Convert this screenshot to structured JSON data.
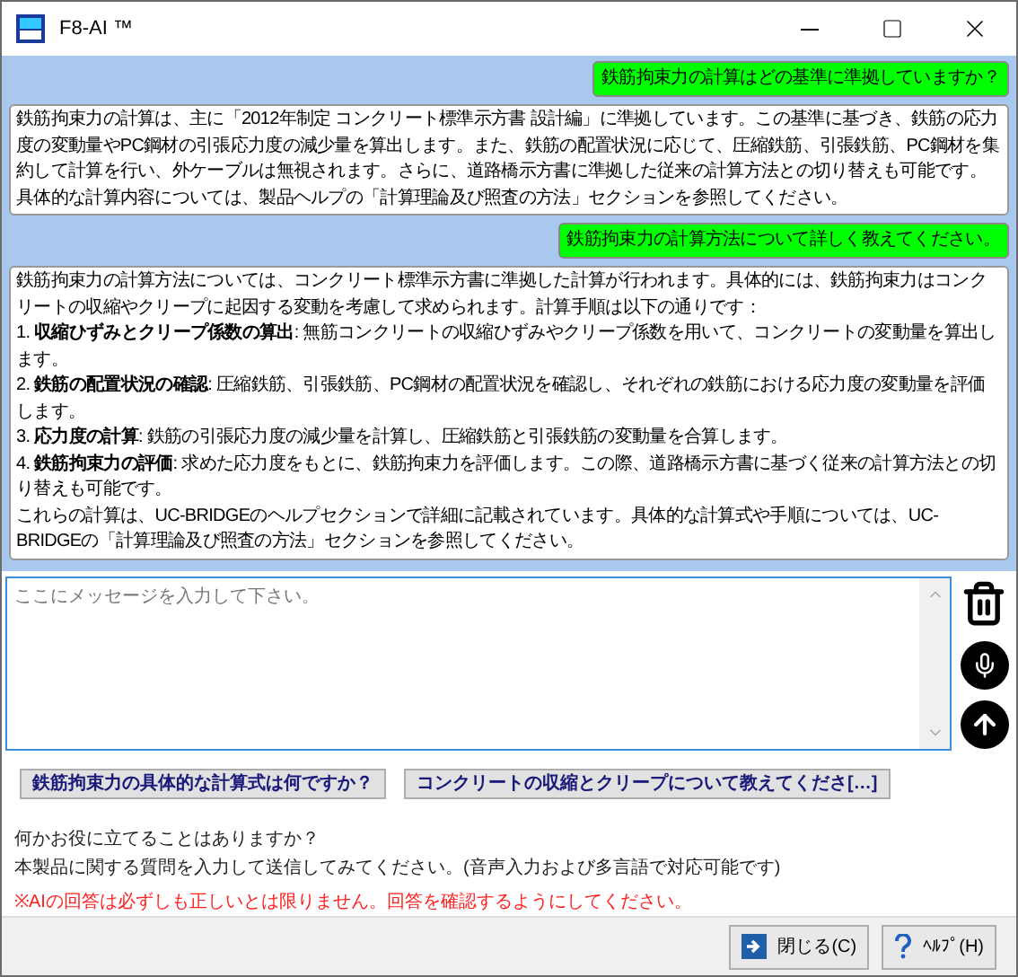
{
  "window": {
    "title": "F8-AI ™"
  },
  "messages": [
    {
      "kind": "user",
      "text": "鉄筋拘束力の計算はどの基準に準拠していますか？"
    },
    {
      "kind": "assistant",
      "paragraphs": [
        "鉄筋拘束力の計算は、主に「2012年制定 コンクリート標準示方書 設計編」に準拠しています。この基準に基づき、鉄筋の応力度の変動量やPC鋼材の引張応力度の減少量を算出します。また、鉄筋の配置状況に応じて、圧縮鉄筋、引張鉄筋、PC鋼材を集約して計算を行い、外ケーブルは無視されます。さらに、道路橋示方書に準拠した従来の計算方法との切り替えも可能です。具体的な計算内容については、製品ヘルプの「計算理論及び照査の方法」セクションを参照してください。"
      ]
    },
    {
      "kind": "user",
      "text": "鉄筋拘束力の計算方法について詳しく教えてください。"
    },
    {
      "kind": "assistant",
      "paragraphs": [
        "鉄筋拘束力の計算方法については、コンクリート標準示方書に準拠した計算が行われます。具体的には、鉄筋拘束力はコンクリートの収縮やクリープに起因する変動を考慮して求められます。計算手順は以下の通りです：",
        "1. **収縮ひずみとクリープ係数の算出**: 無筋コンクリートの収縮ひずみやクリープ係数を用いて、コンクリートの変動量を算出します。",
        "2. **鉄筋の配置状況の確認**: 圧縮鉄筋、引張鉄筋、PC鋼材の配置状況を確認し、それぞれの鉄筋における応力度の変動量を評価します。",
        "3. **応力度の計算**: 鉄筋の引張応力度の減少量を計算し、圧縮鉄筋と引張鉄筋の変動量を合算します。",
        "4. **鉄筋拘束力の評価**: 求めた応力度をもとに、鉄筋拘束力を評価します。この際、道路橋示方書に基づく従来の計算方法との切り替えも可能です。",
        "これらの計算は、UC-BRIDGEのヘルプセクションで詳細に記載されています。具体的な計算式や手順については、UC-BRIDGEの「計算理論及び照査の方法」セクションを参照してください。"
      ]
    }
  ],
  "input": {
    "placeholder": "ここにメッセージを入力して下さい。"
  },
  "suggestions": [
    "鉄筋拘束力の具体的な計算式は何ですか？",
    "コンクリートの収縮とクリープについて教えてくださ[…]"
  ],
  "info": [
    {
      "kind": "normal",
      "text": "何かお役に立てることはありますか？"
    },
    {
      "kind": "normal",
      "text": "本製品に関する質問を入力して送信してみてください。(音声入力および多言語で対応可能です)"
    },
    {
      "kind": "warning",
      "text": "※AIの回答は必ずしも正しいとは限りません。回答を確認するようにしてください。"
    }
  ],
  "footer_buttons": [
    {
      "kind": "close",
      "label": "閉じる(C)"
    },
    {
      "kind": "help",
      "label": "ﾍﾙﾌﾟ(H)"
    }
  ]
}
